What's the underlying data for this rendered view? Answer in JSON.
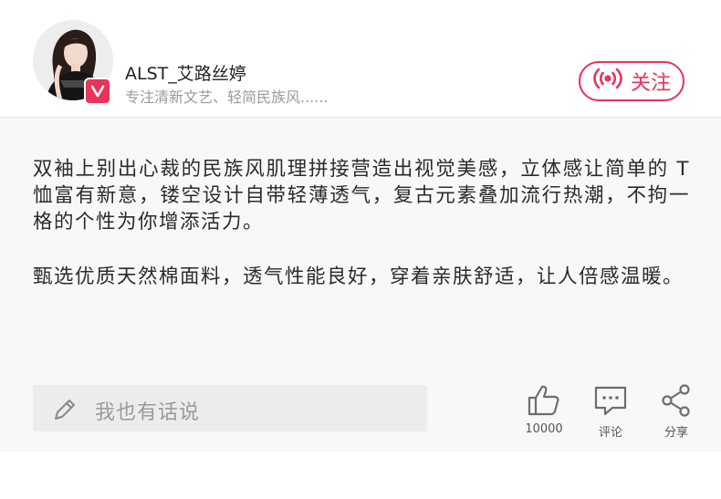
{
  "profile": {
    "username": "ALST_艾路丝婷",
    "signature": "专注清新文艺、轻简民族风......",
    "follow_label": "关注"
  },
  "description": {
    "paragraph1": "双袖上别出心裁的民族风肌理拼接营造出视觉美感，立体感让简单的 T 恤富有新意，镂空设计自带轻薄透气，复古元素叠加流行热潮，不拘一格的个性为你增添活力。",
    "paragraph2": "甄选优质天然棉面料，透气性能良好，穿着亲肤舒适，让人倍感温暖。"
  },
  "comment_input": {
    "placeholder": "我也有话说"
  },
  "actions": {
    "like": {
      "icon": "thumbs-up-icon",
      "label": "10000"
    },
    "comment": {
      "icon": "comment-icon",
      "label": "评论"
    },
    "share": {
      "icon": "share-icon",
      "label": "分享"
    }
  },
  "colors": {
    "accent": "#e8335a",
    "content_bg": "#f8f8f8",
    "input_bg": "#ececec"
  }
}
